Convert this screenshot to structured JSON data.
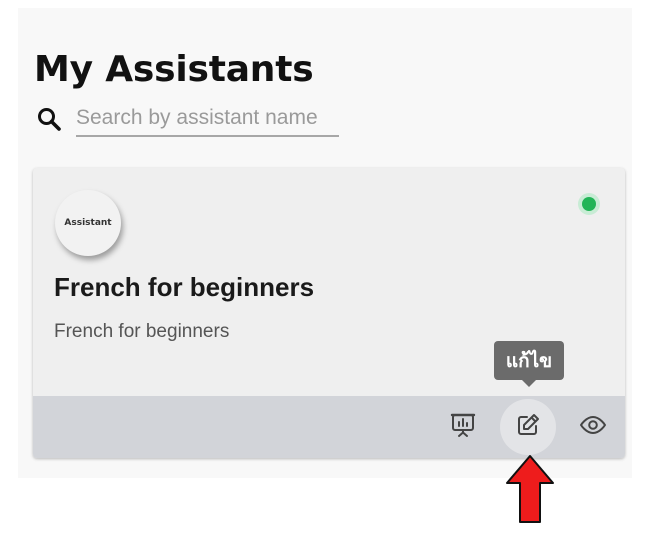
{
  "page": {
    "title": "My Assistants"
  },
  "search": {
    "placeholder": "Search by assistant name",
    "icon": "search-icon"
  },
  "assistant_card": {
    "avatar_text": "Assistant",
    "title": "French for beginners",
    "description": "French for beginners",
    "status_color": "#22b457",
    "actions": {
      "present_icon": "presentation-icon",
      "edit_icon": "edit-icon",
      "view_icon": "eye-icon",
      "edit_tooltip": "แก้ไข"
    }
  },
  "annotation": {
    "arrow_color": "#ee1c1c"
  }
}
